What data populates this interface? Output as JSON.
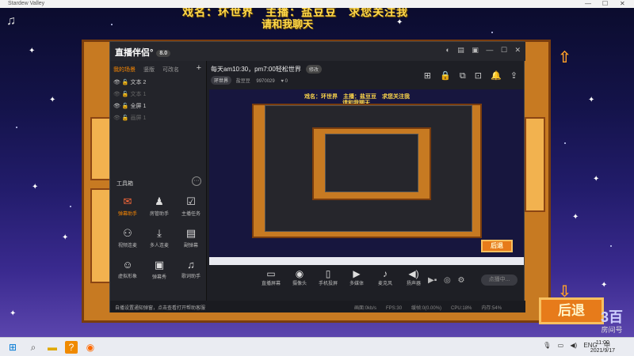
{
  "outer_window": {
    "title": "Stardew Valley",
    "controls": [
      "—",
      "☐",
      "✕"
    ]
  },
  "game_banner": {
    "line1": "戏名：环世界　主播：盐豆豆　求您关注我",
    "line2": "请和我聊天"
  },
  "game_buttons": {
    "back_big": "后退",
    "back_small": "后退"
  },
  "watermark": {
    "top": "3百",
    "bottom": "房间号"
  },
  "app": {
    "logo": "直播伴侣°",
    "version_badge": "8.0",
    "scene_tabs": [
      "我的场景",
      "竖版",
      "可改名"
    ],
    "sources": [
      {
        "label": "文本 2",
        "dim": false
      },
      {
        "label": "文本 1",
        "dim": true
      },
      {
        "label": "全屏 1",
        "dim": false
      },
      {
        "label": "画屏 1",
        "dim": true
      }
    ],
    "tools_title": "工具箱",
    "tools": [
      {
        "label": "弹幕助手",
        "icon": "comment-icon",
        "glyph": "✉",
        "hot": true
      },
      {
        "label": "房管助手",
        "icon": "user-icon",
        "glyph": "♟",
        "hot": false
      },
      {
        "label": "主播任务",
        "icon": "task-icon",
        "glyph": "☑",
        "hot": false
      },
      {
        "label": "视频连麦",
        "icon": "video-link-icon",
        "glyph": "⚇",
        "hot": false
      },
      {
        "label": "多人连麦",
        "icon": "download-icon",
        "glyph": "⤓",
        "hot": false
      },
      {
        "label": "副弹幕",
        "icon": "danmu-icon",
        "glyph": "▤",
        "hot": false
      },
      {
        "label": "虚拟形象",
        "icon": "avatar-icon",
        "glyph": "☺",
        "hot": false
      },
      {
        "label": "弹幕秀",
        "icon": "show-icon",
        "glyph": "▣",
        "hot": false
      },
      {
        "label": "歌词助手",
        "icon": "lyrics-icon",
        "glyph": "♫",
        "hot": false
      }
    ],
    "stream_title": "每天am10:30，pm7:00轻松世界",
    "edit_label": "修改",
    "room_chip": "环世界",
    "host": "盐豆豆",
    "room_id": "9970029",
    "viewers": "0",
    "bottom_tools": [
      {
        "label": "直播屏幕",
        "icon": "screen-icon",
        "glyph": "▭"
      },
      {
        "label": "摄像头",
        "icon": "camera-icon",
        "glyph": "◉"
      },
      {
        "label": "手机投屏",
        "icon": "phone-icon",
        "glyph": "▯"
      },
      {
        "label": "多媒体",
        "icon": "media-icon",
        "glyph": "▶"
      },
      {
        "label": "麦克风",
        "icon": "mic-icon",
        "glyph": "🎙"
      },
      {
        "label": "扬声器",
        "icon": "speaker-icon",
        "glyph": "🔊"
      }
    ],
    "start_live": "点播中...",
    "status_msg": "自播设置通知弹窗，点击查看打开帮助客服",
    "stats": [
      "画面:0kb/s",
      "FPS:30",
      "缓帧:0(0.00%)",
      "CPU:18%",
      "内存:54%"
    ]
  },
  "taskbar": {
    "tray": [
      "ENG",
      "中"
    ],
    "time": "11:00",
    "date": "2021/9/17"
  }
}
